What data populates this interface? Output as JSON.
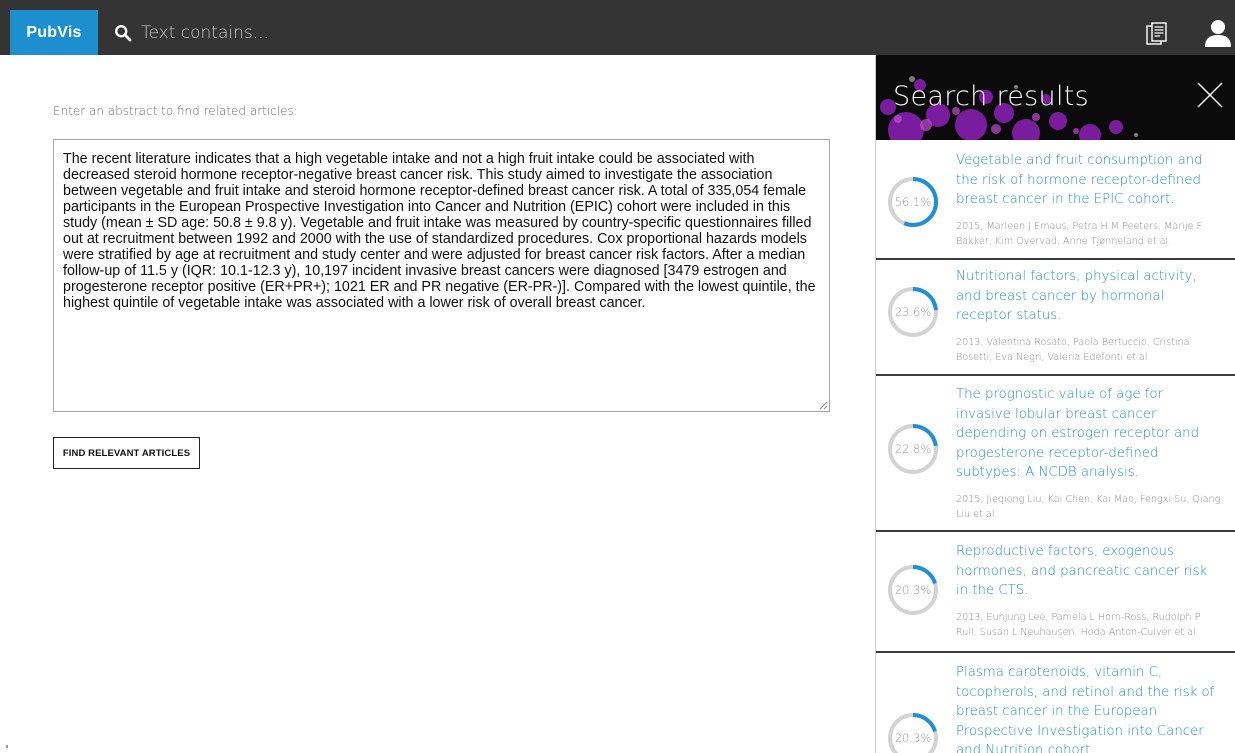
{
  "app": {
    "logo": "PubVis"
  },
  "search": {
    "placeholder": "Text contains..."
  },
  "main": {
    "prompt": "Enter an abstract to find related articles:",
    "abstract": "The recent literature indicates that a high vegetable intake and not a high fruit intake could be associated with decreased steroid hormone receptor-negative breast cancer risk. This study aimed to investigate the association between vegetable and fruit intake and steroid hormone receptor-defined breast cancer risk. A total of 335,054 female participants in the European Prospective Investigation into Cancer and Nutrition (EPIC) cohort were included in this study (mean ± SD age: 50.8 ± 9.8 y). Vegetable and fruit intake was measured by country-specific questionnaires filled out at recruitment between 1992 and 2000 with the use of standardized procedures. Cox proportional hazards models were stratified by age at recruitment and study center and were adjusted for breast cancer risk factors. After a median follow-up of 11.5 y (IQR: 10.1-12.3 y), 10,197 incident invasive breast cancers were diagnosed [3479 estrogen and progesterone receptor positive (ER+PR+); 1021 ER and PR negative (ER-PR-)]. Compared with the lowest quintile, the highest quintile of vegetable intake was associated with a lower risk of overall breast cancer.",
    "find_button": "FIND RELEVANT ARTICLES"
  },
  "panel": {
    "title": "Search results",
    "accent_color": "#1e90d6",
    "results": [
      {
        "score_label": "56.1%",
        "score": 0.561,
        "title": "Vegetable and fruit consumption and the risk of hormone receptor-defined breast cancer in the EPIC cohort.",
        "meta": "2015, Marleen J Emaus, Petra H M Peeters, Marije F Bakker, Kim Overvad, Anne Tjønneland et al."
      },
      {
        "score_label": "23.6%",
        "score": 0.236,
        "title": "Nutritional factors, physical activity, and breast cancer by hormonal receptor status.",
        "meta": "2013, Valentina Rosato, Paola Bertuccio, Cristina Bosetti, Eva Negri, Valeria Edefonti et al."
      },
      {
        "score_label": "22.8%",
        "score": 0.228,
        "title": "The prognostic value of age for invasive lobular breast cancer depending on estrogen receptor and progesterone receptor-defined subtypes: A NCDB analysis.",
        "meta": "2015, Jieqiong Liu, Kai Chen, Kai Mao, Fengxi Su, Qiang Liu et al."
      },
      {
        "score_label": "20.3%",
        "score": 0.203,
        "title": "Reproductive factors, exogenous hormones, and pancreatic cancer risk in the CTS.",
        "meta": "2013, Eunjung Lee, Pamela L Horn-Ross, Rudolph P Rull, Susan L Neuhausen, Hoda Anton-Culver et al."
      },
      {
        "score_label": "20.3%",
        "score": 0.203,
        "title": "Plasma carotenoids, vitamin C, tocopherols, and retinol and the risk of breast cancer in the European Prospective Investigation into Cancer and Nutrition cohort.",
        "meta": ""
      }
    ]
  }
}
